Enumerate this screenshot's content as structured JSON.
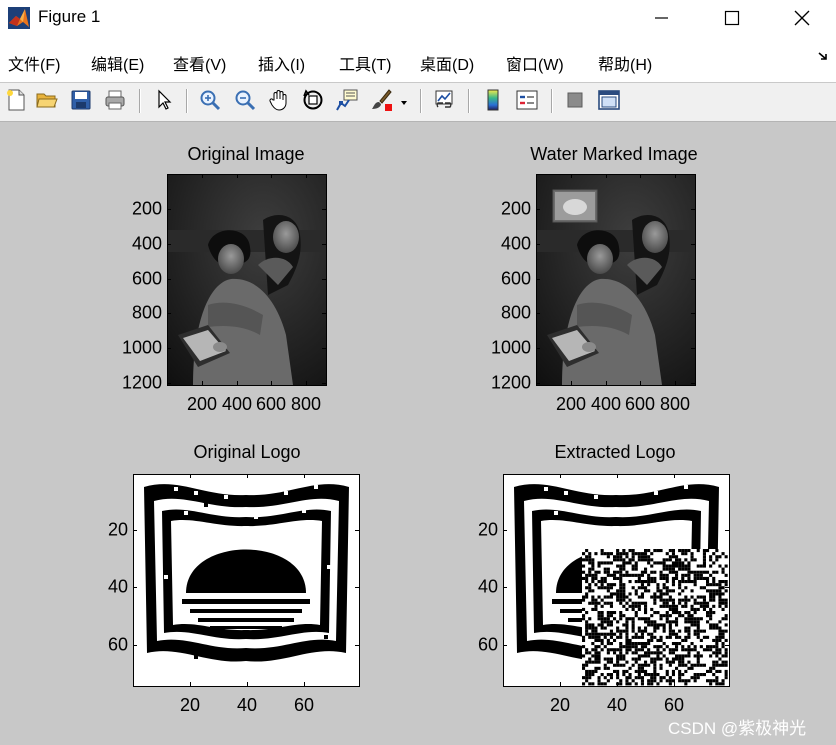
{
  "window": {
    "title": "Figure 1",
    "controls": {
      "minimize": "minimize",
      "maximize": "maximize",
      "close": "close"
    }
  },
  "menubar": {
    "items": [
      "文件(F)",
      "编辑(E)",
      "查看(V)",
      "插入(I)",
      "工具(T)",
      "桌面(D)",
      "窗口(W)",
      "帮助(H)"
    ]
  },
  "toolbar": {
    "buttons": [
      "new-figure",
      "open-file",
      "save-figure",
      "print-figure",
      "edit-plot",
      "zoom-in",
      "zoom-out",
      "pan",
      "rotate-3d",
      "data-cursor",
      "brush",
      "brush-dropdown",
      "link-plot",
      "insert-colorbar",
      "insert-legend",
      "hide-plot-tools",
      "show-plot-tools"
    ]
  },
  "axes": {
    "original_image": {
      "title": "Original Image",
      "y_ticks": [
        "200",
        "400",
        "600",
        "800",
        "1000",
        "1200"
      ],
      "x_ticks": [
        "200",
        "400",
        "600",
        "800"
      ]
    },
    "watermarked_image": {
      "title": "Water Marked Image",
      "y_ticks": [
        "200",
        "400",
        "600",
        "800",
        "1000",
        "1200"
      ],
      "x_ticks": [
        "200",
        "400",
        "600",
        "800"
      ]
    },
    "original_logo": {
      "title": "Original Logo",
      "y_ticks": [
        "20",
        "40",
        "60"
      ],
      "x_ticks": [
        "20",
        "40",
        "60"
      ]
    },
    "extracted_logo": {
      "title": "Extracted Logo",
      "y_ticks": [
        "20",
        "40",
        "60"
      ],
      "x_ticks": [
        "20",
        "40",
        "60"
      ]
    }
  },
  "watermark_text": "CSDN @紫极神光",
  "colors": {
    "figure_bg": "#c8c8c8",
    "titlebar_bg": "#ffffff",
    "toolbar_bg": "#f0f0f0",
    "photo_dark": "#1a1a1a"
  }
}
